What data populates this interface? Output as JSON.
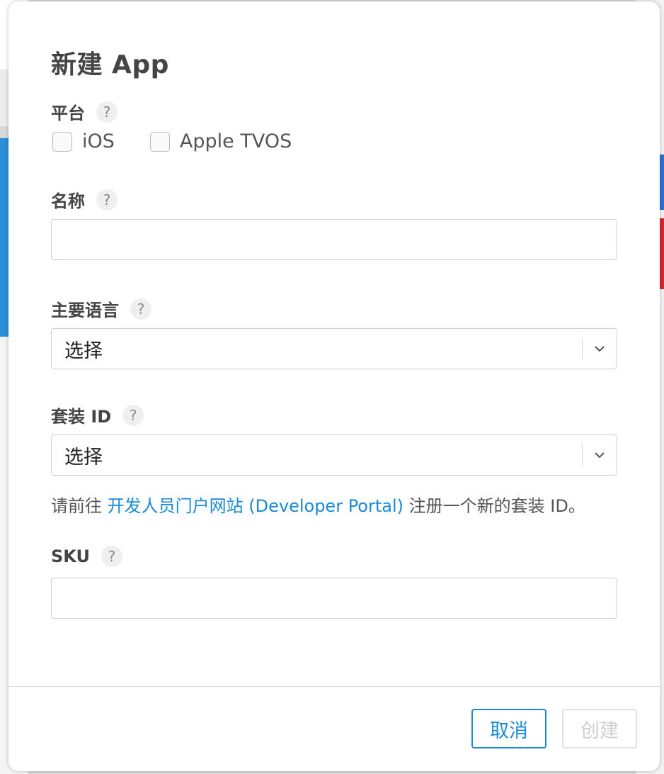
{
  "dialog": {
    "title": "新建 App",
    "help_glyph": "?",
    "platform": {
      "label": "平台",
      "options": [
        {
          "label": "iOS",
          "checked": false
        },
        {
          "label": "Apple TVOS",
          "checked": false
        }
      ]
    },
    "name": {
      "label": "名称",
      "value": ""
    },
    "primary_language": {
      "label": "主要语言",
      "selected": "选择"
    },
    "bundle_id": {
      "label": "套装 ID",
      "selected": "选择"
    },
    "bundle_hint": {
      "prefix": "请前往 ",
      "link": "开发人员门户网站 (Developer Portal)",
      "suffix": " 注册一个新的套装 ID。"
    },
    "sku": {
      "label": "SKU",
      "value": ""
    },
    "buttons": {
      "cancel": "取消",
      "create": "创建"
    }
  },
  "icons": [
    "help-icon",
    "chevron-down-icon"
  ],
  "colors": {
    "accent": "#1a8ad6",
    "disabled_text": "#cfcfcf"
  }
}
